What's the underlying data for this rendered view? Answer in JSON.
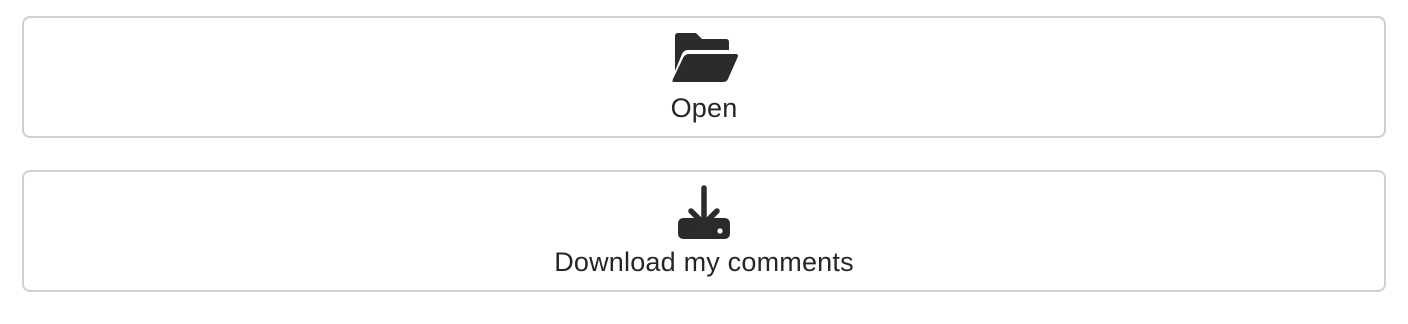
{
  "actions": {
    "open": {
      "label": "Open",
      "icon": "folder-open-icon"
    },
    "download": {
      "label": "Download my comments",
      "icon": "download-icon"
    }
  },
  "colors": {
    "icon": "#2b2b2b",
    "text": "#262626",
    "border": "#cfcfcf",
    "background": "#ffffff"
  }
}
